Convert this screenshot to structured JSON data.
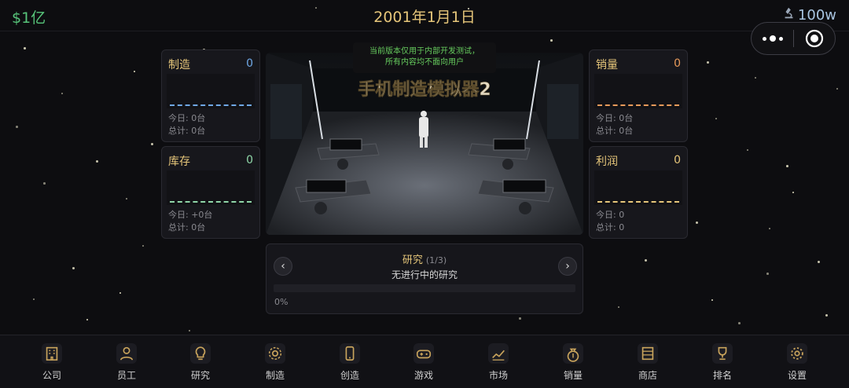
{
  "topbar": {
    "money": "$1亿",
    "date": "2001年1月1日",
    "fans": "100w",
    "fans_icon": "microscope-icon"
  },
  "miniprogram_capsule": {
    "more_icon": "more-dots-icon",
    "close_icon": "target-circle-icon"
  },
  "notice": {
    "line1": "当前版本仅用于内部开发测试，",
    "line2": "所有内容均不面向用户"
  },
  "scene": {
    "title": "手机制造模拟器2"
  },
  "cards": {
    "manufacture": {
      "title": "制造",
      "value": "0",
      "today": "今日: 0台",
      "total": "总计: 0台",
      "color": "#6fa8e6"
    },
    "inventory": {
      "title": "库存",
      "value": "0",
      "today": "今日: +0台",
      "total": "总计: 0台",
      "color": "#8fd6a8"
    },
    "sales": {
      "title": "销量",
      "value": "0",
      "today": "今日: 0台",
      "total": "总计: 0台",
      "color": "#e89a5a"
    },
    "profit": {
      "title": "利润",
      "value": "0",
      "today": "今日: 0",
      "total": "总计: 0",
      "color": "#e6c67a"
    }
  },
  "research": {
    "title": "研究",
    "count": "(1/3)",
    "status": "无进行中的研究",
    "progress": 0,
    "progress_label": "0%",
    "prev_label": "‹",
    "next_label": "›"
  },
  "nav": [
    {
      "label": "公司",
      "icon": "building-icon"
    },
    {
      "label": "员工",
      "icon": "person-icon"
    },
    {
      "label": "研究",
      "icon": "lightbulb-icon"
    },
    {
      "label": "制造",
      "icon": "gear-icon"
    },
    {
      "label": "创造",
      "icon": "phone-icon"
    },
    {
      "label": "游戏",
      "icon": "gamepad-icon"
    },
    {
      "label": "市场",
      "icon": "trend-chart-icon"
    },
    {
      "label": "销量",
      "icon": "money-bag-icon"
    },
    {
      "label": "商店",
      "icon": "store-icon"
    },
    {
      "label": "排名",
      "icon": "trophy-icon"
    },
    {
      "label": "设置",
      "icon": "settings-icon"
    }
  ],
  "colors": {
    "gold": "#e6c67a",
    "green": "#57c47a",
    "bg": "#0d0d10"
  }
}
